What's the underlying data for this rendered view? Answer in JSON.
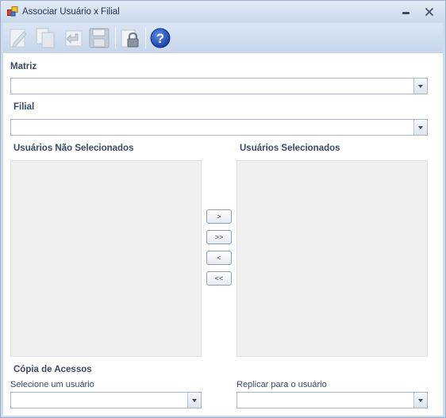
{
  "window": {
    "title": "Associar Usuário x Filial"
  },
  "toolbar": {
    "buttons": [
      {
        "icon": "edit-icon"
      },
      {
        "icon": "copy-icon"
      },
      {
        "icon": "undo-icon"
      },
      {
        "icon": "save-icon"
      },
      {
        "icon": "lock-icon"
      },
      {
        "icon": "help-icon"
      }
    ]
  },
  "matriz": {
    "label": "Matriz",
    "value": ""
  },
  "filial": {
    "label": "Filial",
    "value": ""
  },
  "lists": {
    "available_label": "Usuários Não Selecionados",
    "selected_label": "Usuários Selecionados",
    "available_items": [],
    "selected_items": []
  },
  "move_buttons": {
    "add_one": ">",
    "add_all": ">>",
    "remove_one": "<",
    "remove_all": "<<"
  },
  "copy": {
    "label": "Cópia de Acessos",
    "source_label": "Selecione um usuário",
    "source_value": "",
    "target_label": "Replicar para o usuário",
    "target_value": ""
  },
  "colors": {
    "window_bg": "#cfdcec",
    "accent": "#1e395b",
    "list_bg": "#efefef"
  }
}
